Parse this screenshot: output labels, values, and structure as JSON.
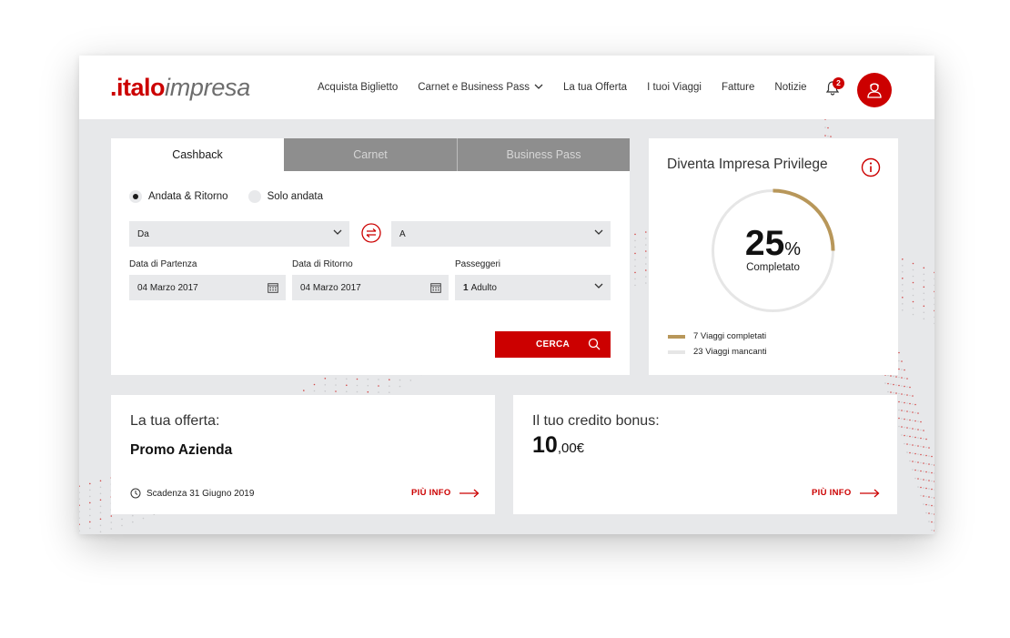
{
  "brand": {
    "logo_part1": ".italo",
    "logo_part2": "impresa",
    "accent": "#cc0000",
    "gold": "#b8975a"
  },
  "nav": {
    "items": [
      {
        "label": "Acquista Biglietto"
      },
      {
        "label": "Carnet e Business Pass",
        "icon": "chevron-down-icon"
      },
      {
        "label": "La tua Offerta"
      },
      {
        "label": "I tuoi Viaggi"
      },
      {
        "label": "Fatture"
      },
      {
        "label": "Notizie"
      }
    ],
    "notifications_count": "2",
    "bell_icon": "bell-icon",
    "avatar_icon": "user-icon"
  },
  "booking": {
    "tabs": [
      {
        "label": "Cashback",
        "active": true
      },
      {
        "label": "Carnet",
        "active": false
      },
      {
        "label": "Business Pass",
        "active": false
      }
    ],
    "trip_types": [
      {
        "label": "Andata & Ritorno",
        "selected": true
      },
      {
        "label": "Solo andata",
        "selected": false
      }
    ],
    "from": {
      "value": "Da"
    },
    "to": {
      "value": "A"
    },
    "departure": {
      "label": "Data di Partenza",
      "value": "04 Marzo 2017"
    },
    "return": {
      "label": "Data di Ritorno",
      "value": "04 Marzo 2017"
    },
    "passengers": {
      "label": "Passeggeri",
      "count": "1",
      "value": "Adulto"
    },
    "search_label": "CERCA"
  },
  "privilege": {
    "title": "Diventa Impresa Privilege",
    "percent": "25",
    "percent_sign": "%",
    "percent_value": 0.25,
    "subtitle": "Completato",
    "completed_label": "7 Viaggi completati",
    "missing_label": "23 Viaggi mancanti",
    "completed_color": "#b8975a",
    "missing_color": "#e6e6e6"
  },
  "offer": {
    "title": "La tua offerta:",
    "value": "Promo Azienda",
    "expiry": "Scadenza 31 Giugno 2019",
    "more_label": "PIÙ INFO"
  },
  "credit": {
    "title": "Il tuo credito bonus:",
    "amount_int": "10",
    "amount_dec": ",00€",
    "more_label": "PIÙ INFO"
  }
}
